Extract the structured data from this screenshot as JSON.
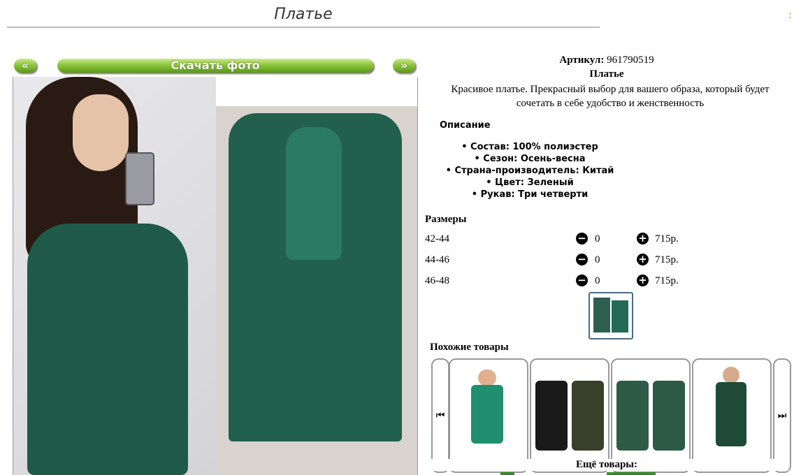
{
  "page": {
    "title": "Платье"
  },
  "gallery": {
    "prev_label": "«",
    "download_label": "Скачать фото",
    "next_label": "»"
  },
  "product": {
    "sku_label": "Артикул:",
    "sku_value": "961790519",
    "name": "Платье",
    "description": "Красивое платье. Прекрасный выбор для вашего образа, который будет сочетать в себе удобство и женственность",
    "description_heading": "Описание",
    "specs": [
      "Состав: 100% полиэстер",
      "Сезон: Осень-весна",
      "Страна-производитель: Китай",
      "Цвет: Зеленый",
      "Рукав: Три четверти"
    ]
  },
  "sizes": {
    "heading": "Размеры",
    "rows": [
      {
        "size": "42-44",
        "qty": "0",
        "price": "715р."
      },
      {
        "size": "44-46",
        "qty": "0",
        "price": "715р."
      },
      {
        "size": "46-48",
        "qty": "0",
        "price": "715р."
      }
    ]
  },
  "similar": {
    "heading": "Похожие товары",
    "prev_icon": "carousel-prev-icon",
    "next_icon": "carousel-next-icon"
  },
  "more": {
    "heading": "Ещё товары:"
  },
  "colors": {
    "accent_green": "#8dc63f",
    "dress_green": "#1f5a48"
  }
}
